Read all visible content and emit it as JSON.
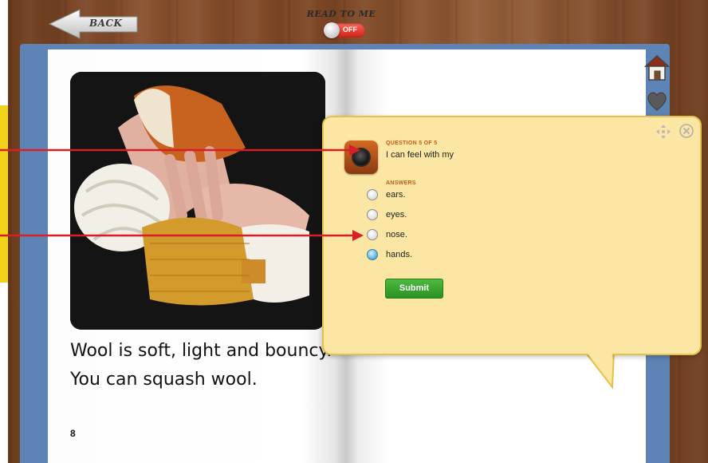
{
  "header": {
    "back_label": "BACK",
    "read_to_me_label": "READ TO ME",
    "toggle_state": "OFF"
  },
  "page": {
    "text": "Wool is soft, light and bouncy. You can squash wool.",
    "number": "8"
  },
  "side_nav": {
    "home_icon": "home-icon",
    "favorite_icon": "heart-icon"
  },
  "question": {
    "counter": "QUESTION 5 OF 5",
    "text": "I can feel with my",
    "answers_heading": "ANSWERS",
    "answers": [
      {
        "label": "ears.",
        "selected": false
      },
      {
        "label": "eyes.",
        "selected": false
      },
      {
        "label": "nose.",
        "selected": false
      },
      {
        "label": "hands.",
        "selected": true
      }
    ],
    "submit_label": "Submit"
  },
  "colors": {
    "toggle_off": "#d01f14",
    "popup_background": "#fbe6a3",
    "submit_button": "#2c8f24",
    "annotation_arrow": "#d61f26",
    "book_frame": "#5e83b5"
  }
}
